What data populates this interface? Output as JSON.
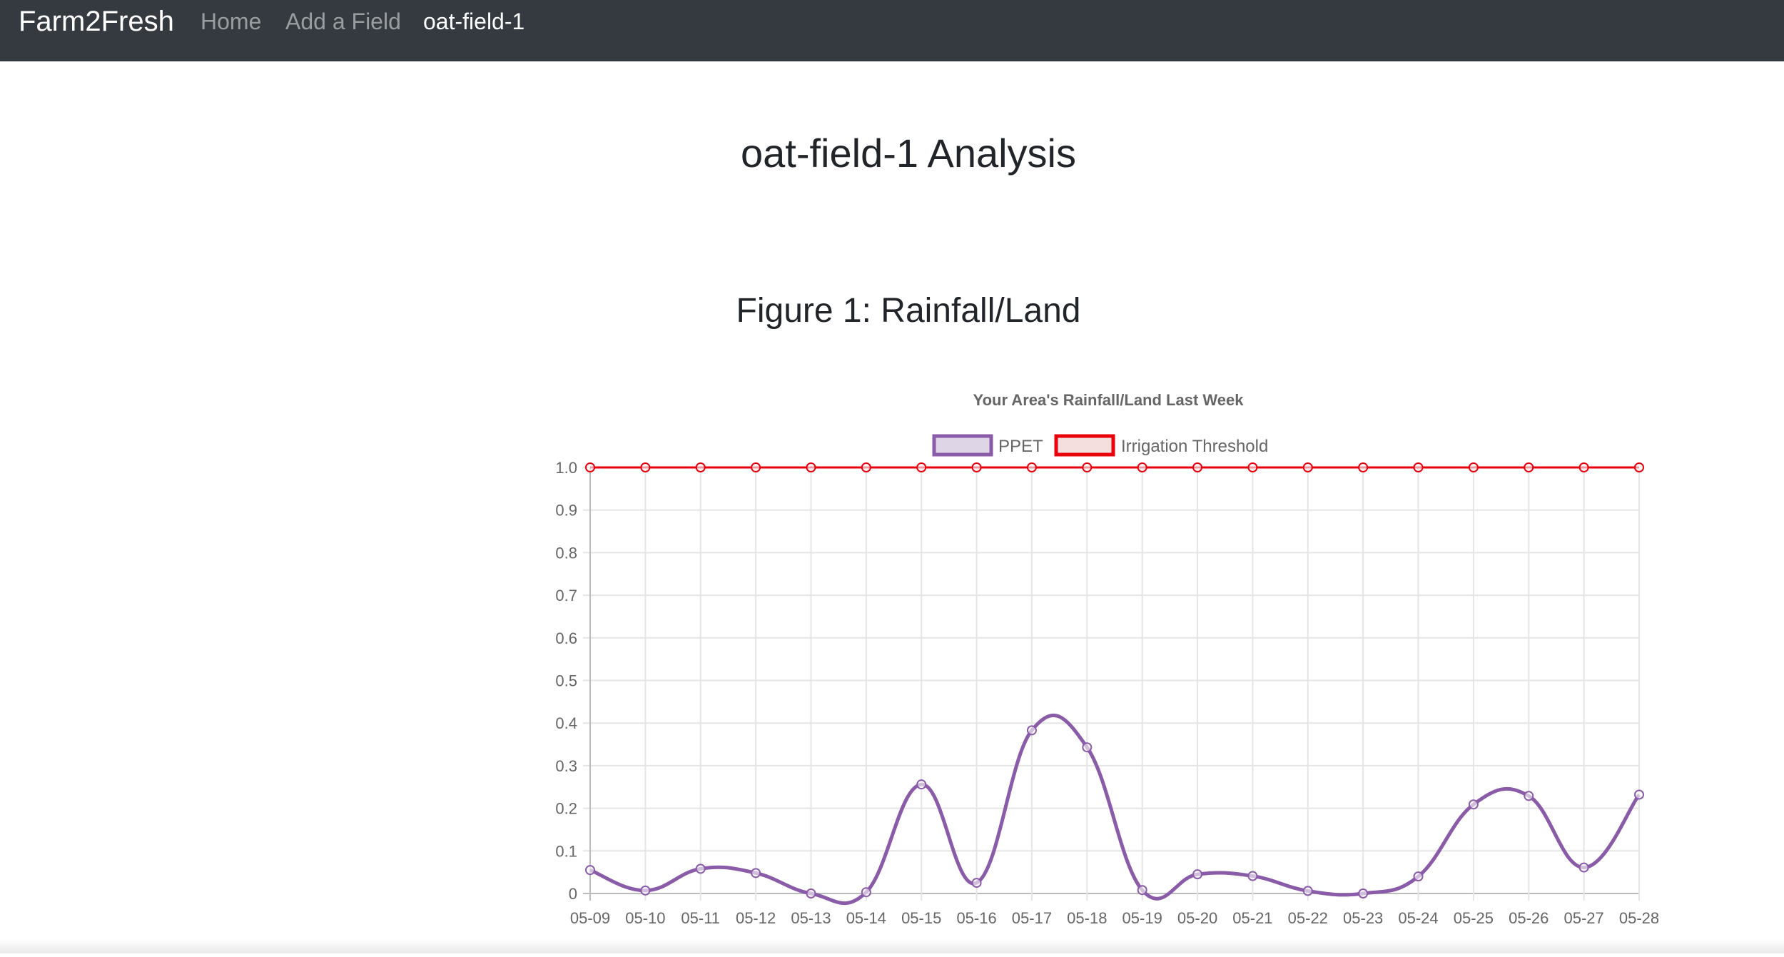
{
  "navbar": {
    "brand": "Farm2Fresh",
    "links": [
      {
        "label": "Home",
        "active": false
      },
      {
        "label": "Add a Field",
        "active": false
      },
      {
        "label": "oat-field-1",
        "active": true
      }
    ]
  },
  "page": {
    "title": "oat-field-1 Analysis",
    "figure_title": "Figure 1: Rainfall/Land"
  },
  "colors": {
    "navbar_bg": "#343a40",
    "ppet_line": "#8a5ba8",
    "ppet_fill": "#ded6e6",
    "threshold_line": "#e8000b",
    "threshold_fill": "#f4dede",
    "grid": "#e5e5e5",
    "tick_text": "#666666"
  },
  "chart_data": {
    "type": "line",
    "title": "Your Area's Rainfall/Land Last Week",
    "x": [
      "05-09",
      "05-10",
      "05-11",
      "05-12",
      "05-13",
      "05-14",
      "05-15",
      "05-16",
      "05-17",
      "05-18",
      "05-19",
      "05-20",
      "05-21",
      "05-22",
      "05-23",
      "05-24",
      "05-25",
      "05-26",
      "05-27",
      "05-28"
    ],
    "series": [
      {
        "name": "PPET",
        "values": [
          0.055,
          0.007,
          0.058,
          0.048,
          0.0,
          0.003,
          0.256,
          0.025,
          0.383,
          0.343,
          0.008,
          0.045,
          0.041,
          0.006,
          0.0,
          0.04,
          0.209,
          0.229,
          0.061,
          0.232
        ],
        "color": "#8a5ba8",
        "smooth": true
      },
      {
        "name": "Irrigation Threshold",
        "values": [
          1,
          1,
          1,
          1,
          1,
          1,
          1,
          1,
          1,
          1,
          1,
          1,
          1,
          1,
          1,
          1,
          1,
          1,
          1,
          1
        ],
        "color": "#e8000b",
        "smooth": false
      }
    ],
    "y_ticks": [
      "0",
      "0.1",
      "0.2",
      "0.3",
      "0.4",
      "0.5",
      "0.6",
      "0.7",
      "0.8",
      "0.9",
      "1.0"
    ],
    "ylim": [
      0,
      1
    ],
    "grid": true,
    "legend_position": "top"
  }
}
